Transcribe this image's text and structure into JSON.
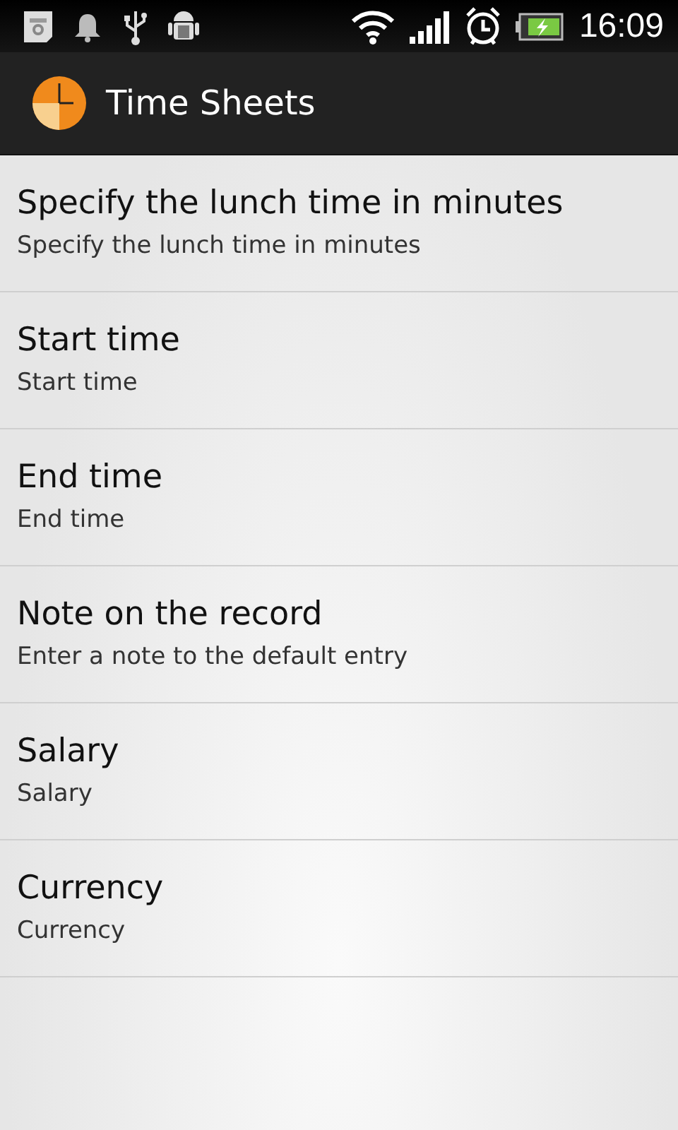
{
  "status_bar": {
    "time": "16:09"
  },
  "action_bar": {
    "title": "Time Sheets"
  },
  "preferences": [
    {
      "title": "Specify the lunch time in minutes",
      "summary": "Specify the lunch time in minutes"
    },
    {
      "title": "Start time",
      "summary": "Start time"
    },
    {
      "title": "End time",
      "summary": "End time"
    },
    {
      "title": "Note on the record",
      "summary": "Enter a note to the default entry"
    },
    {
      "title": "Salary",
      "summary": "Salary"
    },
    {
      "title": "Currency",
      "summary": "Currency"
    }
  ]
}
